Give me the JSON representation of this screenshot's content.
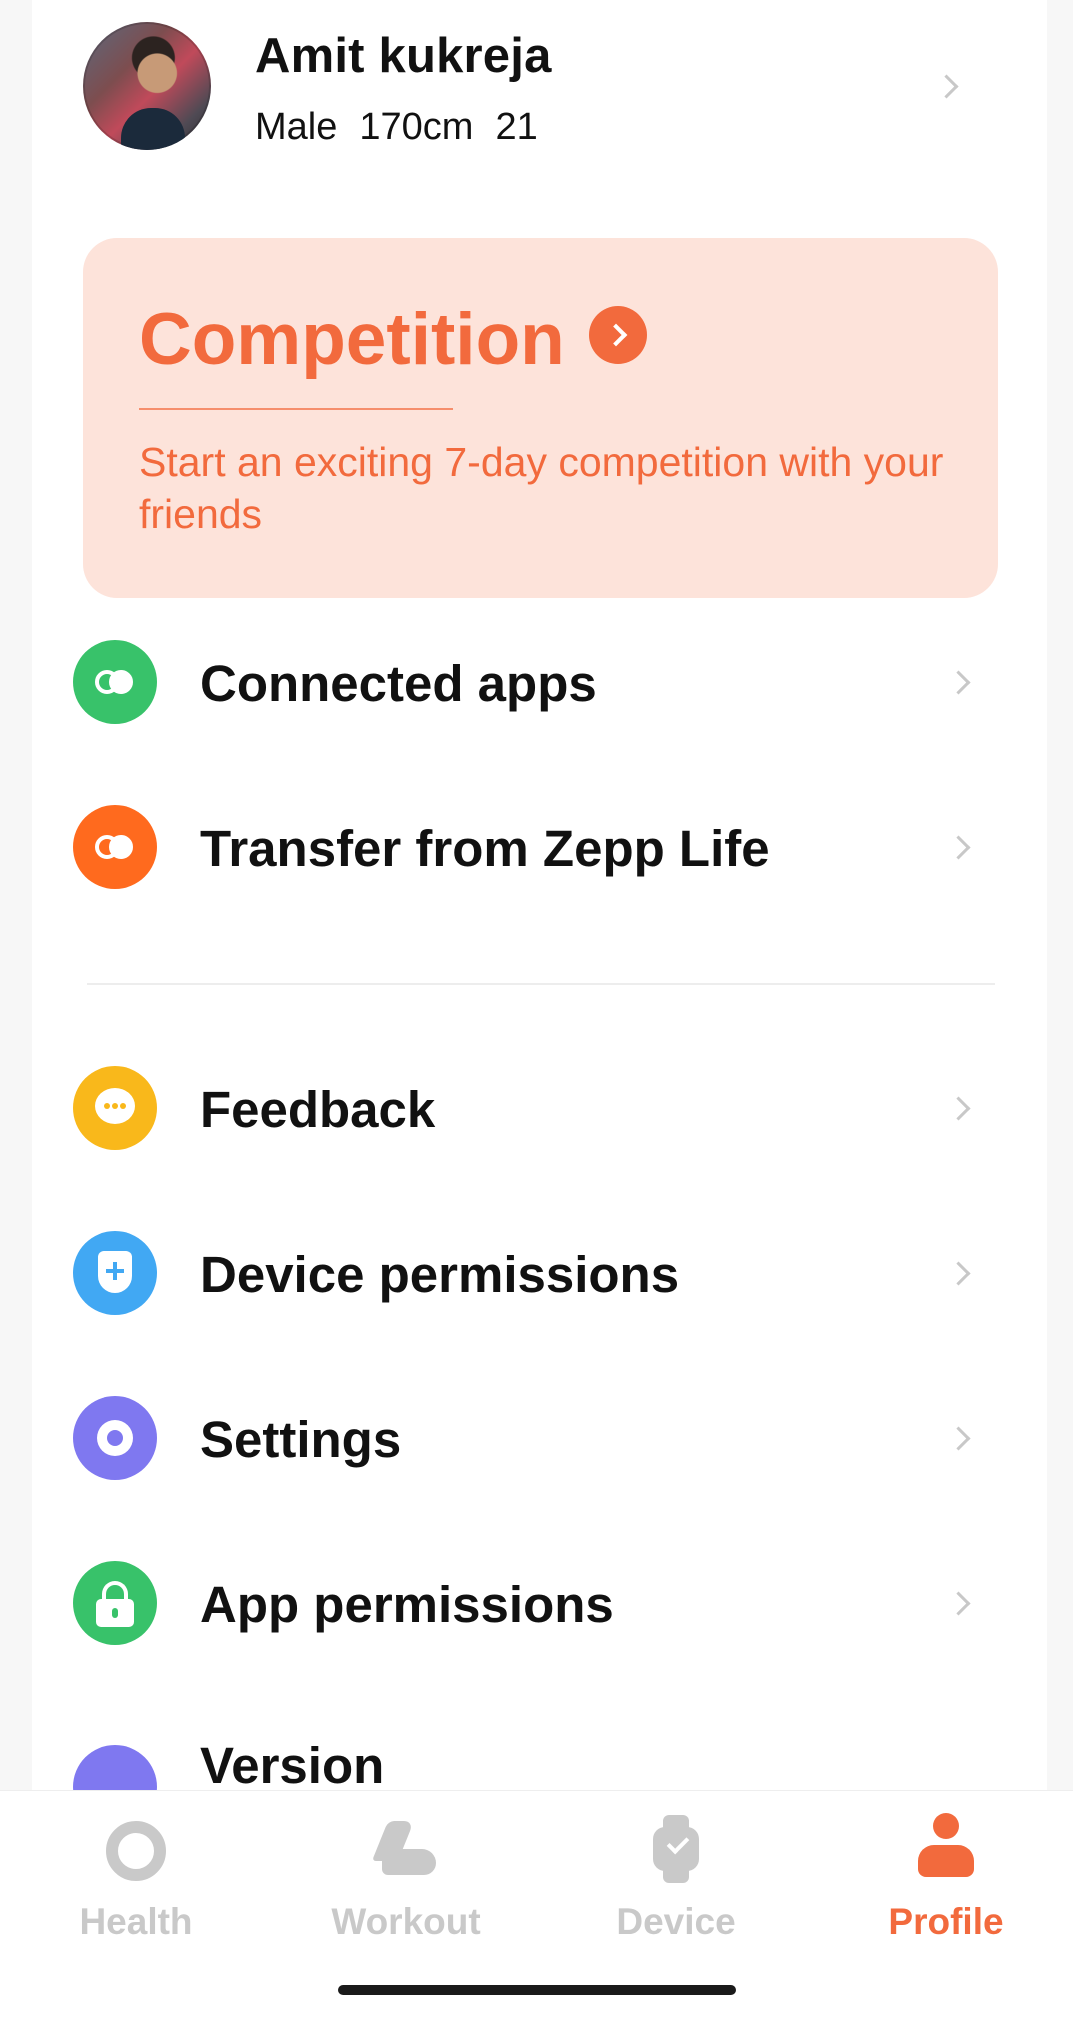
{
  "profile": {
    "name": "Amit kukreja",
    "gender": "Male",
    "height": "170cm",
    "age": "21"
  },
  "competition": {
    "title": "Competition",
    "subtitle": "Start an exciting 7-day competition with your friends"
  },
  "menu": {
    "group1": [
      {
        "label": "Connected apps",
        "icon": "link-icon",
        "color": "#38c26a"
      },
      {
        "label": "Transfer from Zepp Life",
        "icon": "link-icon",
        "color": "#ff6a1e"
      }
    ],
    "group2": [
      {
        "label": "Feedback",
        "icon": "chat-bubble-icon",
        "color": "#f9b81b"
      },
      {
        "label": "Device permissions",
        "icon": "shield-icon",
        "color": "#41a8f3"
      },
      {
        "label": "Settings",
        "icon": "gear-icon",
        "color": "#7f78f0"
      },
      {
        "label": "App permissions",
        "icon": "lock-icon",
        "color": "#38c26a"
      },
      {
        "label": "Version",
        "icon": "version-icon",
        "color": "#7f78f0"
      }
    ]
  },
  "tabs": [
    {
      "label": "Health",
      "icon": "health-ring-icon",
      "active": false
    },
    {
      "label": "Workout",
      "icon": "shoe-icon",
      "active": false
    },
    {
      "label": "Device",
      "icon": "watch-icon",
      "active": false
    },
    {
      "label": "Profile",
      "icon": "person-icon",
      "active": true
    }
  ],
  "colors": {
    "accent": "#f26a3d",
    "card_background": "#fde3da",
    "inactive_tab": "#c9c9c9"
  }
}
